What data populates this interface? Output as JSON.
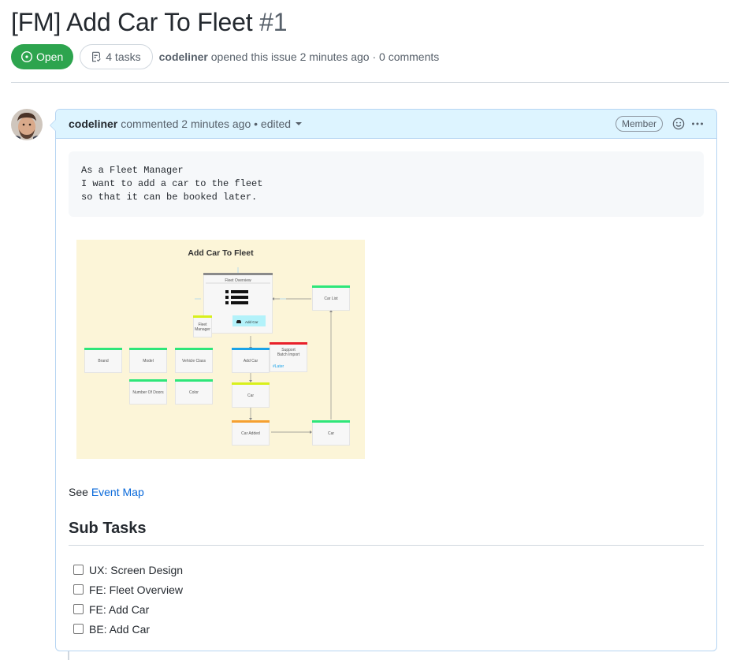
{
  "issue": {
    "title": "[FM] Add Car To Fleet",
    "number": "#1",
    "state": "Open",
    "tasks": "4 tasks",
    "author": "codeliner",
    "opened_text": "opened this issue 2 minutes ago",
    "separator": "·",
    "comments": "0 comments"
  },
  "comment": {
    "author": "codeliner",
    "meta": "commented 2 minutes ago • edited",
    "badge": "Member",
    "code_lines": [
      "As a Fleet Manager",
      "I want to add a car to the fleet",
      "so that it can be booked later."
    ],
    "see_prefix": "See ",
    "see_link": "Event Map",
    "subtasks_heading": "Sub Tasks",
    "tasks": [
      {
        "label": "UX: Screen Design",
        "checked": false
      },
      {
        "label": "FE: Fleet Overview",
        "checked": false
      },
      {
        "label": "FE: Add Car",
        "checked": false
      },
      {
        "label": "BE: Add Car",
        "checked": false
      }
    ]
  },
  "diagram": {
    "title": "Add Car To Fleet",
    "cards": {
      "fleet_overview": "Fleet Overview",
      "add_car_button": "Add Car",
      "car_list": "Car List",
      "fleet_manager": "Fleet Manager",
      "brand": "Brand",
      "model": "Model",
      "vehicle_class": "Vehicle Class",
      "number_of_doors": "Number Of Doors",
      "color": "Color",
      "add_car": "Add Car",
      "support_batch_import": "Support Batch Import",
      "later_tag": "#Later",
      "car_mid": "Car",
      "car_added": "Car Added",
      "car_right": "Car"
    },
    "colors": {
      "background": "#fcf5d8",
      "green": "#2ee67a",
      "blue": "#1aa3e8",
      "yellow": "#d8f01c",
      "red": "#e8202a",
      "orange": "#f5a031",
      "gray": "#8a8a8a"
    }
  },
  "colors": {
    "open_green": "#2da44e",
    "link_blue": "#0969da",
    "header_blue": "#ddf4ff"
  }
}
